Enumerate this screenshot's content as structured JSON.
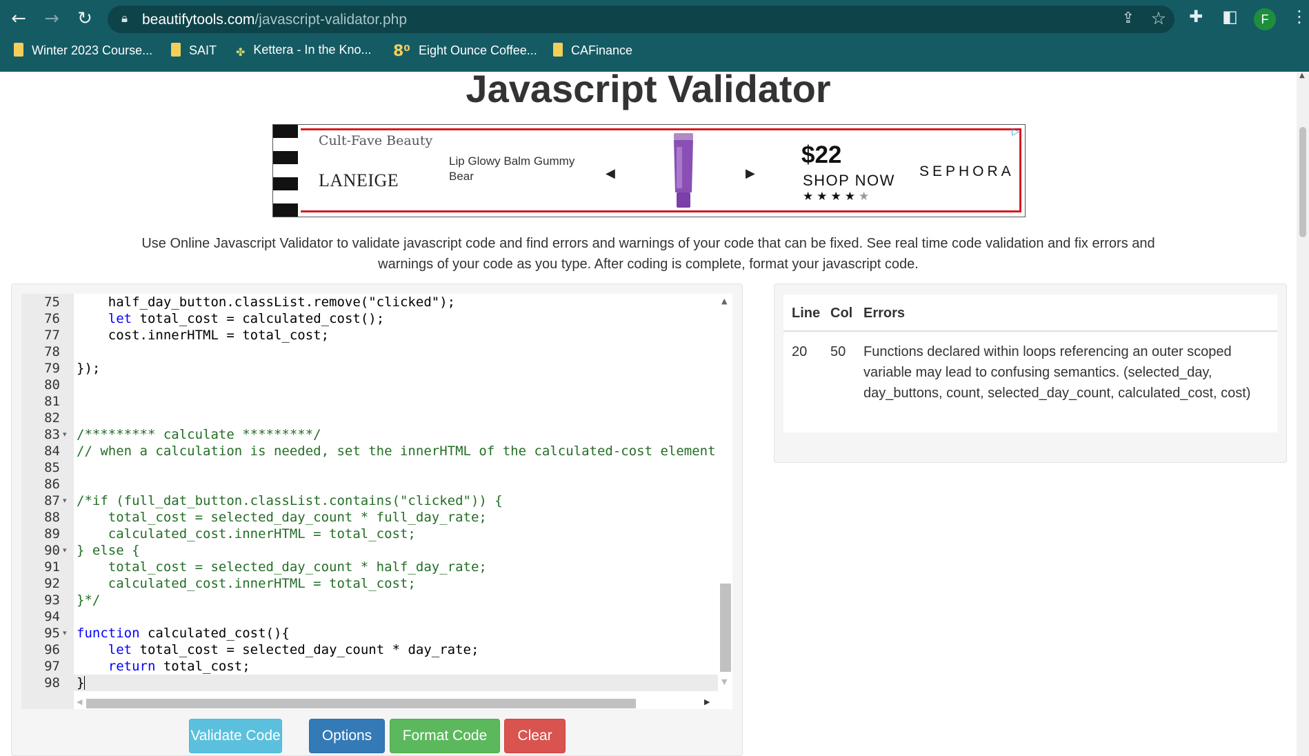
{
  "browser": {
    "url_domain": "beautifytools.com",
    "url_path": "/javascript-validator.php",
    "avatar_letter": "F",
    "bookmarks": [
      {
        "label": "Winter 2023 Course..."
      },
      {
        "label": "SAIT"
      },
      {
        "label": "Kettera - In the Kno..."
      },
      {
        "label": "Eight Ounce Coffee..."
      },
      {
        "label": "CAFinance"
      }
    ]
  },
  "page": {
    "title": "Javascript Validator",
    "description": "Use Online Javascript Validator to validate javascript code and find errors and warnings of your code that can be fixed. See real time code validation and fix errors and warnings of your code as you type. After coding is complete, format your javascript code."
  },
  "ad": {
    "tagline": "Cult-Fave Beauty",
    "brand": "LANEIGE",
    "product": "Lip Glowy Balm Gummy Bear",
    "price": "$22",
    "cta": "SHOP NOW",
    "retailer": "SEPHORA",
    "rating_stars": 4
  },
  "editor": {
    "active_line": "98",
    "lines": [
      {
        "n": "75",
        "fold": false,
        "html": "    half_day_button.classList.remove(\"clicked\");"
      },
      {
        "n": "76",
        "fold": false,
        "html": "    <span class='kw'>let</span> total_cost = calculated_cost();"
      },
      {
        "n": "77",
        "fold": false,
        "html": "    cost.innerHTML = total_cost;"
      },
      {
        "n": "78",
        "fold": false,
        "html": ""
      },
      {
        "n": "79",
        "fold": false,
        "html": "});"
      },
      {
        "n": "80",
        "fold": false,
        "html": ""
      },
      {
        "n": "81",
        "fold": false,
        "html": ""
      },
      {
        "n": "82",
        "fold": false,
        "html": ""
      },
      {
        "n": "83",
        "fold": true,
        "html": "<span class='cm'>/********* calculate *********/</span>"
      },
      {
        "n": "84",
        "fold": false,
        "html": "<span class='cm'>// when a calculation is needed, set the innerHTML of the calculated-cost element</span>"
      },
      {
        "n": "85",
        "fold": false,
        "html": ""
      },
      {
        "n": "86",
        "fold": false,
        "html": ""
      },
      {
        "n": "87",
        "fold": true,
        "html": "<span class='cm'>/*if (full_dat_button.classList.contains(\"clicked\")) {</span>"
      },
      {
        "n": "88",
        "fold": false,
        "html": "<span class='cm'>    total_cost = selected_day_count * full_day_rate;</span>"
      },
      {
        "n": "89",
        "fold": false,
        "html": "<span class='cm'>    calculated_cost.innerHTML = total_cost;</span>"
      },
      {
        "n": "90",
        "fold": true,
        "html": "<span class='cm'>} else {</span>"
      },
      {
        "n": "91",
        "fold": false,
        "html": "<span class='cm'>    total_cost = selected_day_count * half_day_rate;</span>"
      },
      {
        "n": "92",
        "fold": false,
        "html": "<span class='cm'>    calculated_cost.innerHTML = total_cost;</span>"
      },
      {
        "n": "93",
        "fold": false,
        "html": "<span class='cm'>}*/</span>"
      },
      {
        "n": "94",
        "fold": false,
        "html": ""
      },
      {
        "n": "95",
        "fold": true,
        "html": "<span class='kw'>function</span> calculated_cost(){"
      },
      {
        "n": "96",
        "fold": false,
        "html": "    <span class='kw'>let</span> total_cost = selected_day_count * day_rate;"
      },
      {
        "n": "97",
        "fold": false,
        "html": "    <span class='kw'>return</span> total_cost;"
      },
      {
        "n": "98",
        "fold": false,
        "html": "}<span class='cursor'></span>"
      }
    ]
  },
  "buttons": {
    "validate": "Validate Code",
    "options": "Options",
    "format": "Format Code",
    "clear": "Clear"
  },
  "errors": {
    "headers": {
      "line": "Line",
      "col": "Col",
      "errors": "Errors"
    },
    "rows": [
      {
        "line": "20",
        "col": "50",
        "message": "Functions declared within loops referencing an outer scoped variable may lead to confusing semantics. (selected_day, day_buttons, count, selected_day_count, calculated_cost, cost)"
      }
    ]
  },
  "colors": {
    "chrome": "#155b64",
    "validate": "#5bc0de",
    "options": "#337ab7",
    "format": "#5cb85c",
    "clear": "#d9534f"
  }
}
